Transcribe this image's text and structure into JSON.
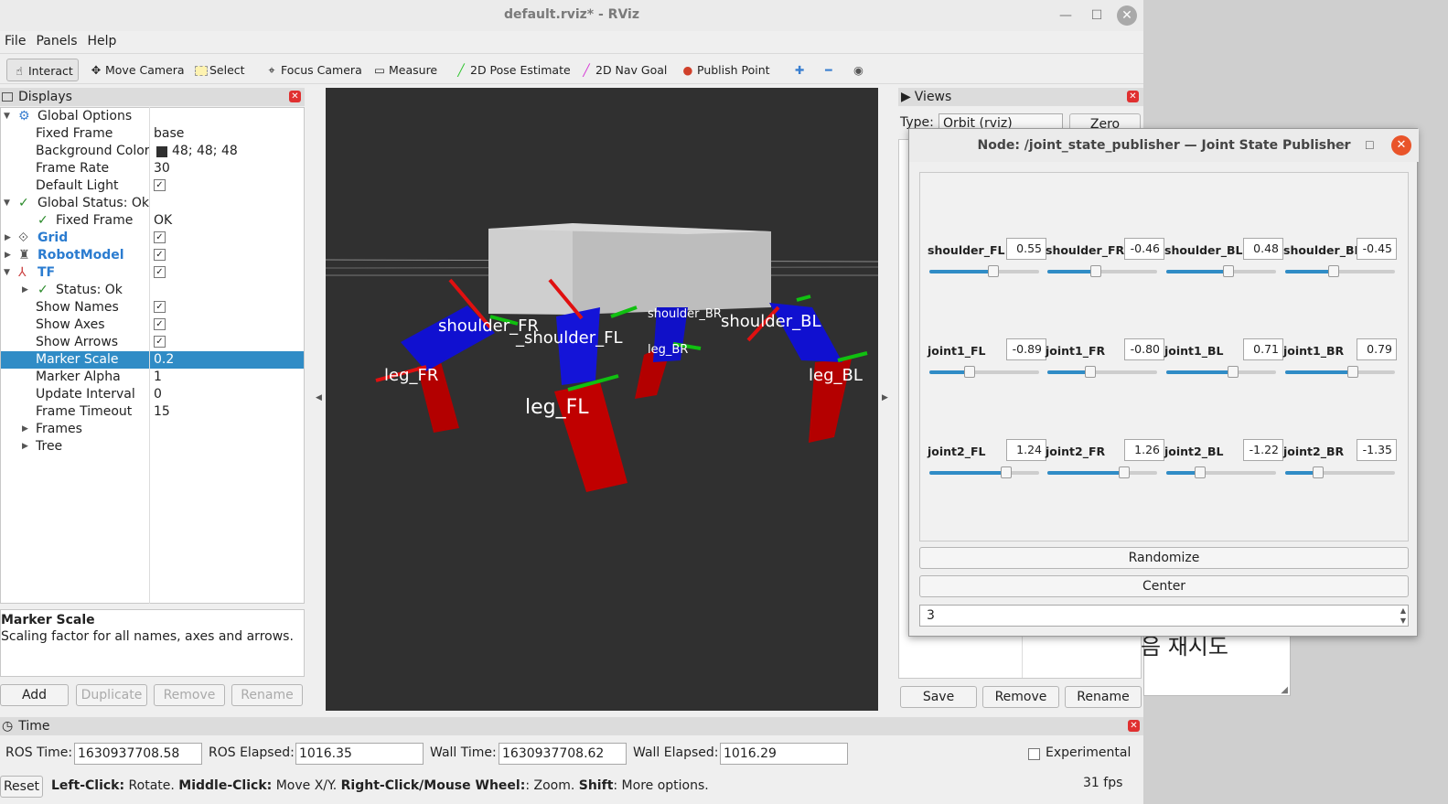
{
  "window": {
    "title": "default.rviz* - RViz"
  },
  "menu": [
    "File",
    "Panels",
    "Help"
  ],
  "toolbar": {
    "interact": "Interact",
    "move_camera": "Move Camera",
    "select": "Select",
    "focus_camera": "Focus Camera",
    "measure": "Measure",
    "pose_estimate": "2D Pose Estimate",
    "nav_goal": "2D Nav Goal",
    "publish_point": "Publish Point"
  },
  "displays": {
    "title": "Displays",
    "rows": {
      "global_options": "Global Options",
      "fixed_frame": {
        "label": "Fixed Frame",
        "value": "base"
      },
      "background_color": {
        "label": "Background Color",
        "value": "48; 48; 48"
      },
      "frame_rate": {
        "label": "Frame Rate",
        "value": "30"
      },
      "default_light": {
        "label": "Default Light"
      },
      "global_status": "Global Status: Ok",
      "fixed_frame_status": {
        "label": "Fixed Frame",
        "value": "OK"
      },
      "grid": "Grid",
      "robot_model": "RobotModel",
      "tf": "TF",
      "tf_status": "Status: Ok",
      "show_names": "Show Names",
      "show_axes": "Show Axes",
      "show_arrows": "Show Arrows",
      "marker_scale": {
        "label": "Marker Scale",
        "value": "0.2"
      },
      "marker_alpha": {
        "label": "Marker Alpha",
        "value": "1"
      },
      "update_interval": {
        "label": "Update Interval",
        "value": "0"
      },
      "frame_timeout": {
        "label": "Frame Timeout",
        "value": "15"
      },
      "frames": "Frames",
      "tree": "Tree"
    },
    "description": {
      "title": "Marker Scale",
      "text": "Scaling factor for all names, axes and arrows."
    },
    "buttons": {
      "add": "Add",
      "duplicate": "Duplicate",
      "remove": "Remove",
      "rename": "Rename"
    }
  },
  "scene_labels": [
    "shoulder_FR",
    "_shoulder_FL",
    "shoulder_BR",
    "shoulder_BL",
    "leg_FR",
    "leg_FL",
    "leg_BR",
    "leg_BL"
  ],
  "views": {
    "title": "Views",
    "type_label": "Type:",
    "type_value": "Orbit (rviz)",
    "zero": "Zero",
    "save": "Save",
    "remove": "Remove",
    "rename": "Rename"
  },
  "time": {
    "title": "Time",
    "ros_time_label": "ROS Time:",
    "ros_time": "1630937708.58",
    "ros_elapsed_label": "ROS Elapsed:",
    "ros_elapsed": "1016.35",
    "wall_time_label": "Wall Time:",
    "wall_time": "1630937708.62",
    "wall_elapsed_label": "Wall Elapsed:",
    "wall_elapsed": "1016.29",
    "experimental": "Experimental"
  },
  "status": {
    "reset": "Reset",
    "hint_1b": "Left-Click:",
    "hint_1": " Rotate. ",
    "hint_2b": "Middle-Click:",
    "hint_2": " Move X/Y. ",
    "hint_3b": "Right-Click/Mouse Wheel:",
    "hint_3": ": Zoom. ",
    "hint_4b": "Shift",
    "hint_4": ": More options.",
    "fps": "31 fps"
  },
  "background_window_text": "음 재시도",
  "jsp": {
    "title": "Node: /joint_state_publisher — Joint State Publisher",
    "joints": [
      {
        "name": "shoulder_FL",
        "value": "0.55",
        "level": 0.58
      },
      {
        "name": "shoulder_FR",
        "value": "-0.46",
        "level": 0.44
      },
      {
        "name": "shoulder_BL",
        "value": "0.48",
        "level": 0.57
      },
      {
        "name": "shoulder_BR",
        "value": "-0.45",
        "level": 0.44
      },
      {
        "name": "joint1_FL",
        "value": "-0.89",
        "level": 0.37
      },
      {
        "name": "joint1_FR",
        "value": "-0.80",
        "level": 0.39
      },
      {
        "name": "joint1_BL",
        "value": "0.71",
        "level": 0.61
      },
      {
        "name": "joint1_BR",
        "value": "0.79",
        "level": 0.62
      },
      {
        "name": "joint2_FL",
        "value": "1.24",
        "level": 0.7
      },
      {
        "name": "joint2_FR",
        "value": "1.26",
        "level": 0.7
      },
      {
        "name": "joint2_BL",
        "value": "-1.22",
        "level": 0.31
      },
      {
        "name": "joint2_BR",
        "value": "-1.35",
        "level": 0.3
      }
    ],
    "randomize": "Randomize",
    "center": "Center",
    "spin_value": "3"
  }
}
